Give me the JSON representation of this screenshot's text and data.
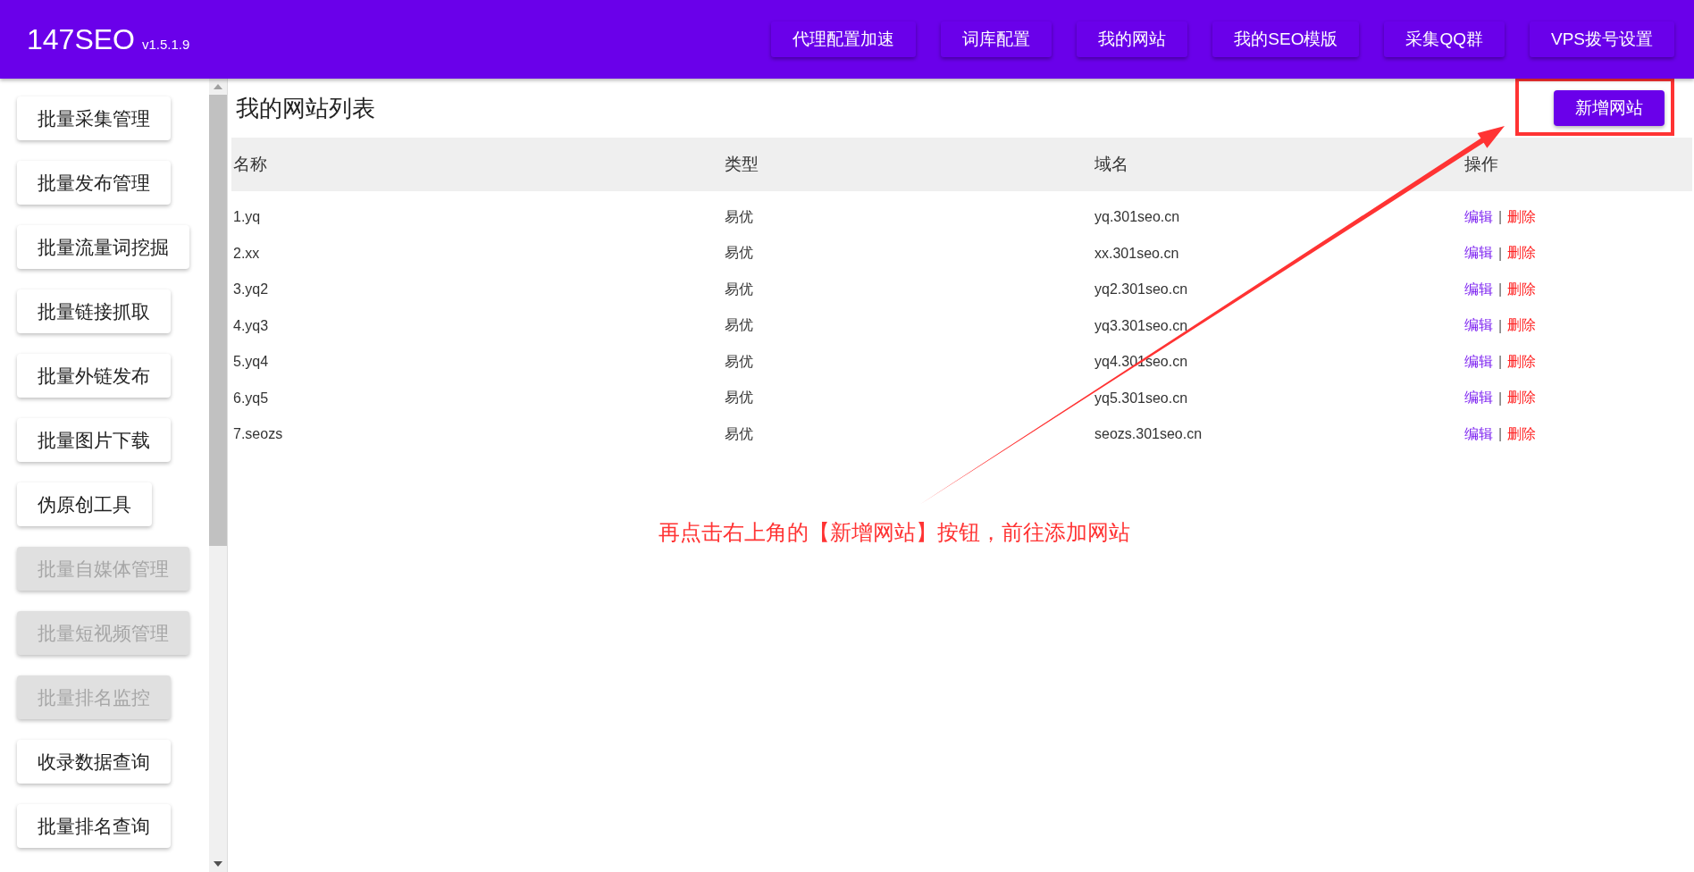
{
  "header": {
    "logo": "147SEO",
    "version": "v1.5.1.9",
    "nav": [
      {
        "label": "代理配置加速"
      },
      {
        "label": "词库配置"
      },
      {
        "label": "我的网站"
      },
      {
        "label": "我的SEO模版"
      },
      {
        "label": "采集QQ群"
      },
      {
        "label": "VPS拨号设置"
      }
    ]
  },
  "sidebar": {
    "items": [
      {
        "label": "批量采集管理",
        "disabled": false
      },
      {
        "label": "批量发布管理",
        "disabled": false
      },
      {
        "label": "批量流量词挖掘",
        "disabled": false
      },
      {
        "label": "批量链接抓取",
        "disabled": false
      },
      {
        "label": "批量外链发布",
        "disabled": false
      },
      {
        "label": "批量图片下载",
        "disabled": false
      },
      {
        "label": "伪原创工具",
        "disabled": false
      },
      {
        "label": "批量自媒体管理",
        "disabled": true
      },
      {
        "label": "批量短视频管理",
        "disabled": true
      },
      {
        "label": "批量排名监控",
        "disabled": true
      },
      {
        "label": "收录数据查询",
        "disabled": false
      },
      {
        "label": "批量排名查询",
        "disabled": false
      }
    ]
  },
  "main": {
    "title": "我的网站列表",
    "add_button": "新增网站",
    "table": {
      "columns": [
        "名称",
        "类型",
        "域名",
        "操作"
      ],
      "rows": [
        {
          "name": "1.yq",
          "type": "易优",
          "domain": "yq.301seo.cn",
          "edit": "编辑",
          "separator": "|",
          "delete": "删除"
        },
        {
          "name": "2.xx",
          "type": "易优",
          "domain": "xx.301seo.cn",
          "edit": "编辑",
          "separator": "|",
          "delete": "删除"
        },
        {
          "name": "3.yq2",
          "type": "易优",
          "domain": "yq2.301seo.cn",
          "edit": "编辑",
          "separator": "|",
          "delete": "删除"
        },
        {
          "name": "4.yq3",
          "type": "易优",
          "domain": "yq3.301seo.cn",
          "edit": "编辑",
          "separator": "|",
          "delete": "删除"
        },
        {
          "name": "5.yq4",
          "type": "易优",
          "domain": "yq4.301seo.cn",
          "edit": "编辑",
          "separator": "|",
          "delete": "删除"
        },
        {
          "name": "6.yq5",
          "type": "易优",
          "domain": "yq5.301seo.cn",
          "edit": "编辑",
          "separator": "|",
          "delete": "删除"
        },
        {
          "name": "7.seozs",
          "type": "易优",
          "domain": "seozs.301seo.cn",
          "edit": "编辑",
          "separator": "|",
          "delete": "删除"
        }
      ]
    }
  },
  "annotation": {
    "text": "再点击右上角的【新增网站】按钮，前往添加网站"
  }
}
